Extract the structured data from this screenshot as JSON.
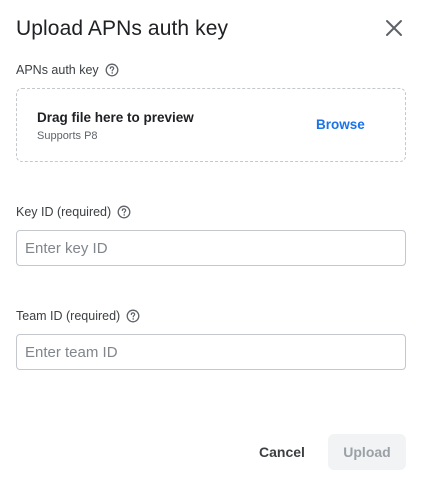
{
  "dialog": {
    "title": "Upload APNs auth key"
  },
  "auth_key": {
    "label": "APNs auth key",
    "dropzone_title": "Drag file here to preview",
    "dropzone_sub": "Supports P8",
    "browse_label": "Browse"
  },
  "key_id": {
    "label": "Key ID (required)",
    "placeholder": "Enter key ID",
    "value": ""
  },
  "team_id": {
    "label": "Team ID (required)",
    "placeholder": "Enter team ID",
    "value": ""
  },
  "actions": {
    "cancel_label": "Cancel",
    "upload_label": "Upload"
  },
  "icons": {
    "close": "close-icon",
    "help": "help-circle-icon"
  },
  "colors": {
    "accent": "#1a73e8",
    "text_primary": "#202124",
    "text_secondary": "#5f6368",
    "border": "#c4c7cc",
    "disabled_bg": "#f1f3f4",
    "disabled_text": "#9aa0a6"
  }
}
